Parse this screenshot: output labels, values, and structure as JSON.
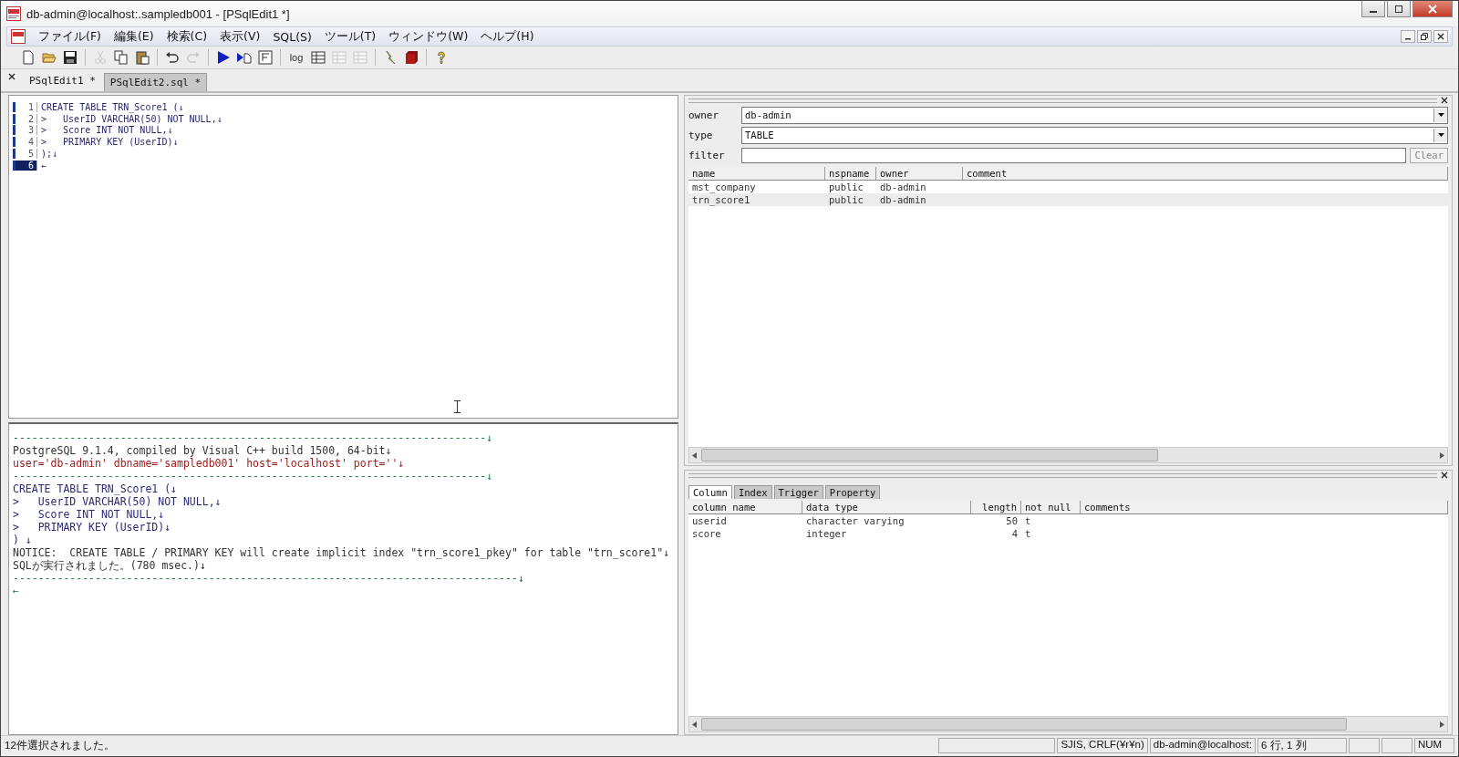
{
  "window": {
    "title": "db-admin@localhost:.sampledb001 - [PSqlEdit1 *]"
  },
  "menu": [
    "ファイル(F)",
    "編集(E)",
    "検索(C)",
    "表示(V)",
    "SQL(S)",
    "ツール(T)",
    "ウィンドウ(W)",
    "ヘルプ(H)"
  ],
  "toolbar": [
    {
      "kind": "new",
      "disabled": false
    },
    {
      "kind": "open",
      "disabled": false
    },
    {
      "kind": "save",
      "disabled": false
    },
    {
      "kind": "sep"
    },
    {
      "kind": "cut",
      "disabled": true
    },
    {
      "kind": "copy",
      "disabled": false
    },
    {
      "kind": "paste",
      "disabled": false
    },
    {
      "kind": "sep"
    },
    {
      "kind": "undo",
      "disabled": false
    },
    {
      "kind": "redo",
      "disabled": true
    },
    {
      "kind": "sep"
    },
    {
      "kind": "run",
      "disabled": false
    },
    {
      "kind": "run-doc",
      "disabled": false
    },
    {
      "kind": "frame",
      "disabled": false
    },
    {
      "kind": "sep"
    },
    {
      "kind": "text",
      "label": "log",
      "disabled": false
    },
    {
      "kind": "grid",
      "disabled": false
    },
    {
      "kind": "grid",
      "disabled": true
    },
    {
      "kind": "grid",
      "disabled": true
    },
    {
      "kind": "sep"
    },
    {
      "kind": "bolt",
      "disabled": false
    },
    {
      "kind": "box",
      "disabled": false
    },
    {
      "kind": "sep"
    },
    {
      "kind": "help",
      "disabled": false
    }
  ],
  "tabs": [
    {
      "label": "PSqlEdit1 *",
      "selected": true
    },
    {
      "label": "PSqlEdit2.sql *",
      "selected": false
    }
  ],
  "editor": {
    "lines": [
      {
        "number": "1",
        "text": "CREATE TABLE TRN_Score1 (↓",
        "current": false
      },
      {
        "number": "2",
        "text": ">   UserID VARCHAR(50) NOT NULL,↓",
        "current": false
      },
      {
        "number": "3",
        "text": ">   Score INT NOT NULL,↓",
        "current": false
      },
      {
        "number": "4",
        "text": ">   PRIMARY KEY (UserID)↓",
        "current": false
      },
      {
        "number": "5",
        "text": ");↓",
        "current": false
      },
      {
        "number": "6",
        "text": "←",
        "current": true
      }
    ]
  },
  "output": {
    "lines": [
      {
        "kind": "rule",
        "text": "---------------------------------------------------------------------------↓"
      },
      {
        "kind": "plain",
        "text": "PostgreSQL 9.1.4, compiled by Visual C++ build 1500, 64-bit↓"
      },
      {
        "kind": "connection",
        "text": "user='db-admin' dbname='sampledb001' host='localhost' port=''↓"
      },
      {
        "kind": "rule",
        "text": "---------------------------------------------------------------------------↓"
      },
      {
        "kind": "sql",
        "text": "CREATE TABLE TRN_Score1 (↓"
      },
      {
        "kind": "sql",
        "text": ">   UserID VARCHAR(50) NOT NULL,↓"
      },
      {
        "kind": "sql",
        "text": ">   Score INT NOT NULL,↓"
      },
      {
        "kind": "sql",
        "text": ">   PRIMARY KEY (UserID)↓"
      },
      {
        "kind": "sql",
        "text": ") ↓"
      },
      {
        "kind": "plain",
        "text": "NOTICE:  CREATE TABLE / PRIMARY KEY will create implicit index \"trn_score1_pkey\" for table \"trn_score1\"↓"
      },
      {
        "kind": "plain",
        "text": "SQLが実行されました。(780 msec.)↓"
      },
      {
        "kind": "rule",
        "text": "--------------------------------------------------------------------------------↓"
      },
      {
        "kind": "rule",
        "text": "←"
      }
    ]
  },
  "object_browser": {
    "owner": {
      "label": "owner",
      "value": "db-admin"
    },
    "type": {
      "label": "type",
      "value": "TABLE"
    },
    "filter": {
      "label": "filter"
    },
    "clear_button": "Clear",
    "columns": [
      "name",
      "nspname",
      "owner",
      "comment"
    ],
    "rows": [
      {
        "cells": [
          "mst_company",
          "public",
          "db-admin"
        ],
        "selected": false
      },
      {
        "cells": [
          "trn_score1",
          "public",
          "db-admin"
        ],
        "selected": true
      }
    ]
  },
  "detail": {
    "tabs": [
      {
        "label": "Column",
        "selected": true
      },
      {
        "label": "Index",
        "selected": false
      },
      {
        "label": "Trigger",
        "selected": false
      },
      {
        "label": "Property",
        "selected": false
      }
    ],
    "columns": [
      "column name",
      "data type",
      "length",
      "not null",
      "comments"
    ],
    "rows": [
      [
        "userid",
        "character varying",
        "50",
        "t"
      ],
      [
        "score",
        "integer",
        "4",
        "t"
      ]
    ]
  },
  "status_bar": {
    "message": "12件選択されました。",
    "encoding": "SJIS, CRLF(¥r¥n)",
    "connection": "db-admin@localhost:",
    "position": "6 行, 1 列",
    "num": "NUM"
  }
}
